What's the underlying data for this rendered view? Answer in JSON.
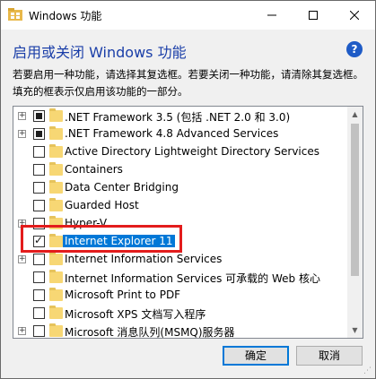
{
  "window": {
    "title": "Windows 功能",
    "minimize_icon": "minimize-icon",
    "maximize_icon": "maximize-icon",
    "close_icon": "close-icon"
  },
  "header": {
    "heading": "启用或关闭 Windows 功能",
    "help_glyph": "?",
    "description": "若要启用一种功能，请选择其复选框。若要关闭一种功能，请清除其复选框。填充的框表示仅启用该功能的一部分。"
  },
  "features": [
    {
      "label": ".NET Framework 3.5 (包括 .NET 2.0 和 3.0)",
      "expandable": true,
      "state": "partial",
      "selected": false
    },
    {
      "label": ".NET Framework 4.8 Advanced Services",
      "expandable": true,
      "state": "partial",
      "selected": false
    },
    {
      "label": "Active Directory Lightweight Directory Services",
      "expandable": false,
      "state": "unchecked",
      "selected": false
    },
    {
      "label": "Containers",
      "expandable": false,
      "state": "unchecked",
      "selected": false
    },
    {
      "label": "Data Center Bridging",
      "expandable": false,
      "state": "unchecked",
      "selected": false
    },
    {
      "label": "Guarded Host",
      "expandable": false,
      "state": "unchecked",
      "selected": false
    },
    {
      "label": "Hyper-V",
      "expandable": true,
      "state": "unchecked",
      "selected": false
    },
    {
      "label": "Internet Explorer 11",
      "expandable": false,
      "state": "checked",
      "selected": true
    },
    {
      "label": "Internet Information Services",
      "expandable": true,
      "state": "unchecked",
      "selected": false
    },
    {
      "label": "Internet Information Services 可承载的 Web 核心",
      "expandable": false,
      "state": "unchecked",
      "selected": false
    },
    {
      "label": "Microsoft Print to PDF",
      "expandable": false,
      "state": "unchecked",
      "selected": false
    },
    {
      "label": "Microsoft XPS 文档写入程序",
      "expandable": false,
      "state": "unchecked",
      "selected": false
    },
    {
      "label": "Microsoft 消息队列(MSMQ)服务器",
      "expandable": true,
      "state": "unchecked",
      "selected": false
    }
  ],
  "buttons": {
    "ok": "确定",
    "cancel": "取消"
  },
  "colors": {
    "heading": "#1a3ea8",
    "selection": "#0078d7",
    "highlight_outline": "#e31c1c"
  }
}
